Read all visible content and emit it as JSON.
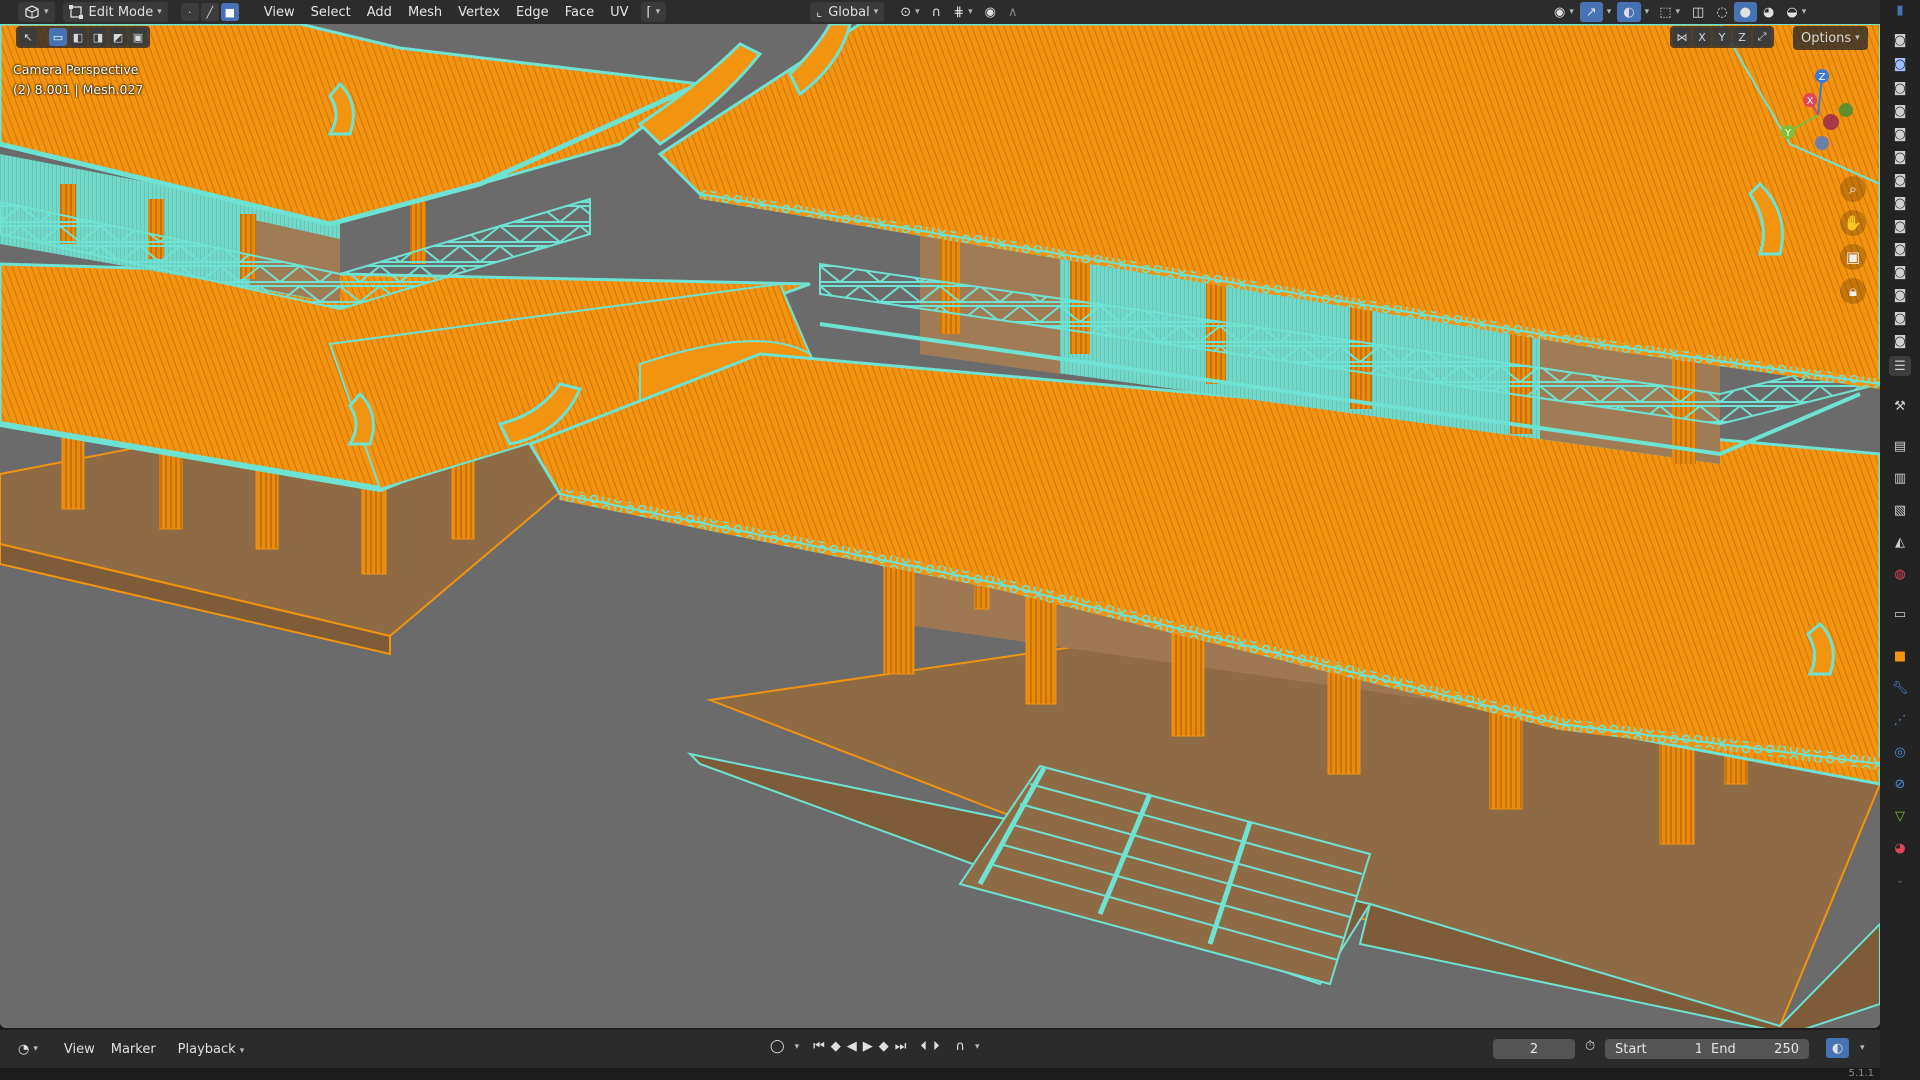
{
  "header": {
    "editor_type_icon": "3d-viewport-icon",
    "mode_label": "Edit Mode",
    "select_modes": [
      "vertex-select-icon",
      "edge-select-icon",
      "face-select-icon"
    ],
    "menus": [
      "View",
      "Select",
      "Add",
      "Mesh",
      "Vertex",
      "Edge",
      "Face",
      "UV"
    ],
    "orientation_label": "Global"
  },
  "viewport": {
    "overlay_title": "Camera Perspective",
    "overlay_object": "(2) 8.001 | Mesh.027",
    "mirror_axes": [
      "X",
      "Y",
      "Z"
    ],
    "options_label": "Options",
    "gizmo_axes": {
      "z": "Z",
      "y": "Y",
      "x": "X"
    },
    "colors": {
      "background": "#6b6b6b",
      "roof_orange": "#f2940f",
      "wire_cyan": "#6fe3d3",
      "wall_tan": "#8f6b45",
      "axis_x": "#e0455a",
      "axis_y": "#7fbf3b",
      "axis_z": "#3c78d8"
    }
  },
  "timeline": {
    "menus": [
      "View",
      "Marker",
      "Playback"
    ],
    "current_frame": "2",
    "start_label": "Start",
    "start_value": "1",
    "end_label": "End",
    "end_value": "250"
  },
  "status": {
    "version": "5.1.1"
  }
}
